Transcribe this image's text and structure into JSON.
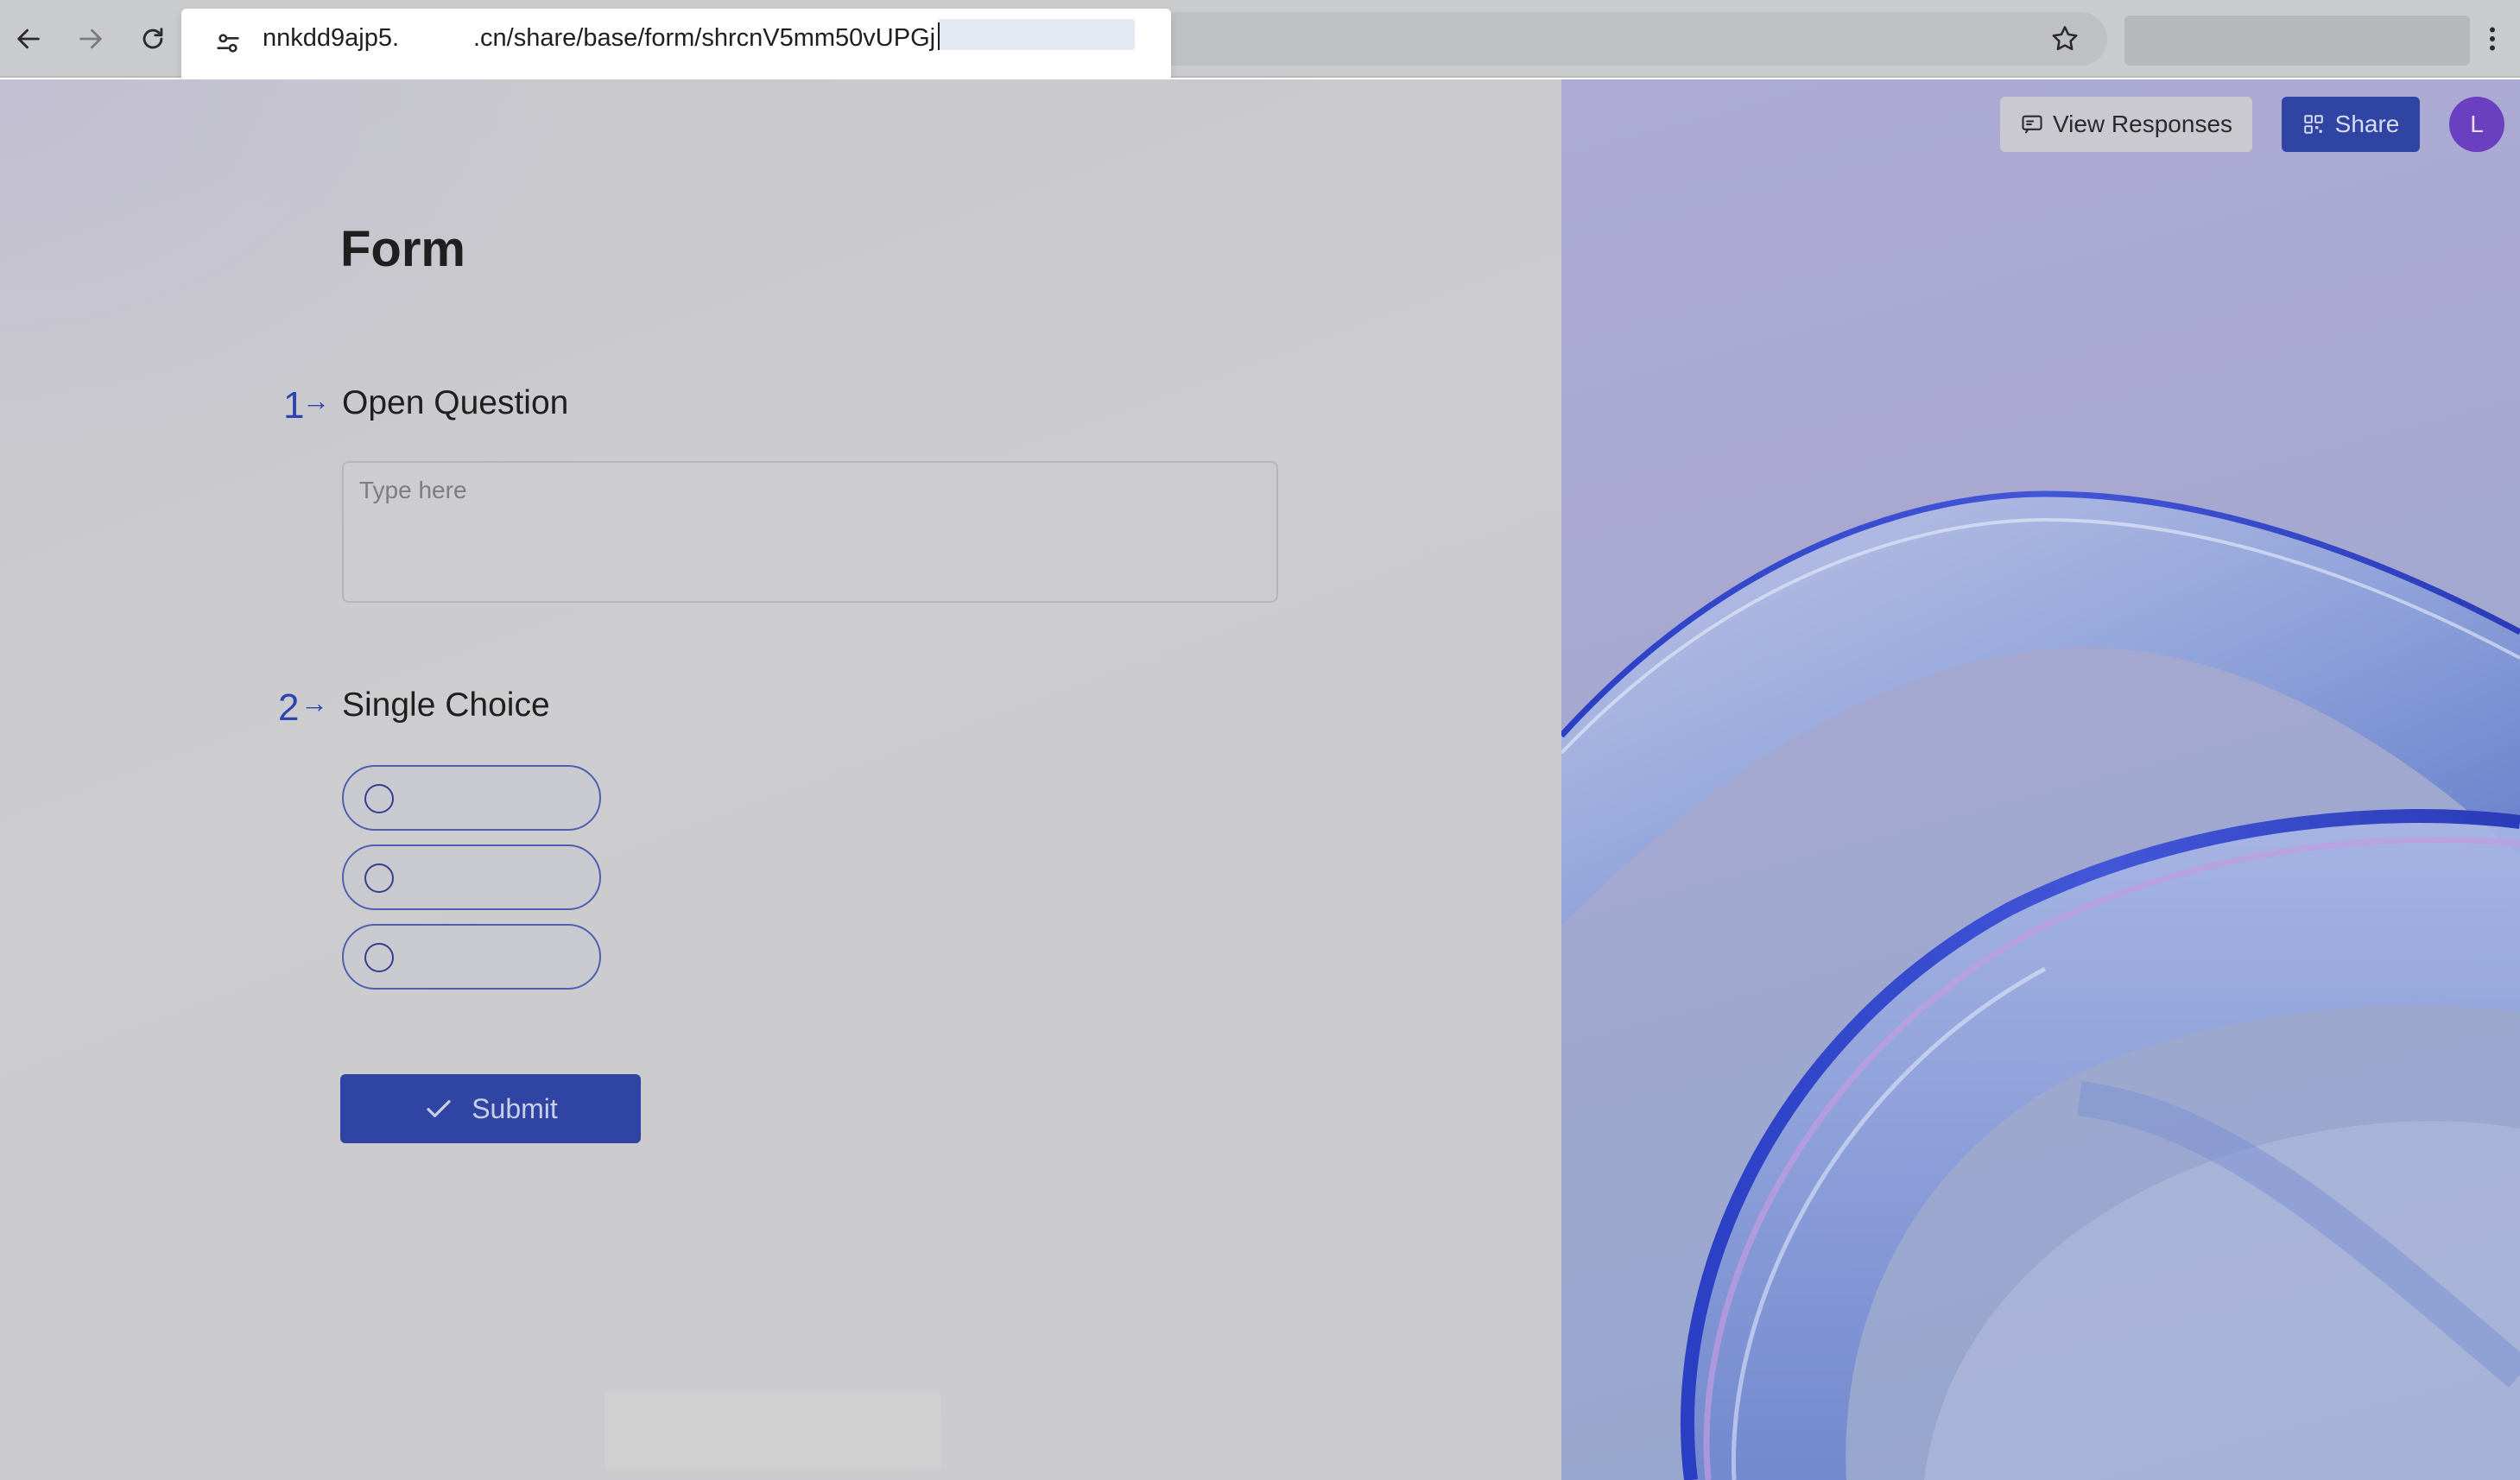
{
  "browser": {
    "url_part1": "nnkdd9ajp5.",
    "url_part2": ".cn/share/base/form/shrcnV5mm50vUPGj"
  },
  "header": {
    "view_responses_label": "View Responses",
    "share_label": "Share",
    "avatar_initial": "L"
  },
  "form": {
    "title": "Form",
    "questions": [
      {
        "number": "1",
        "title": "Open Question",
        "placeholder": "Type here"
      },
      {
        "number": "2",
        "title": "Single Choice",
        "options": [
          "",
          "",
          ""
        ]
      }
    ],
    "submit_label": "Submit"
  },
  "colors": {
    "accent": "#3044a4",
    "avatar": "#6a3fc0",
    "question_number": "#2d44b0"
  }
}
